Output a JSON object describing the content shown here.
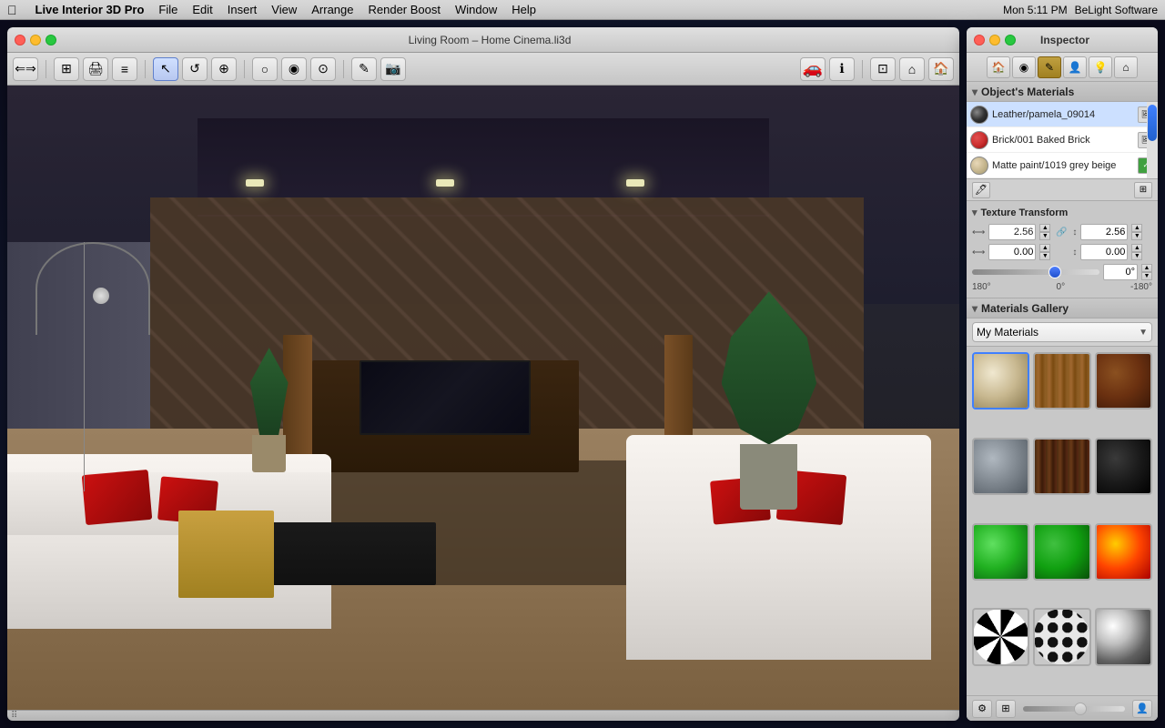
{
  "menubar": {
    "apple": "⌘",
    "items": [
      "Live Interior 3D Pro",
      "File",
      "Edit",
      "Insert",
      "View",
      "Arrange",
      "Render Boost",
      "Window",
      "Help"
    ],
    "right": [
      "Mon 5:11 PM",
      "BeLight Software"
    ]
  },
  "window3d": {
    "title": "Living Room – Home Cinema.li3d",
    "toolbar_buttons": [
      "←→",
      "⊞",
      "🖨",
      "≡",
      "↖",
      "↺",
      "⊕",
      "⊙",
      "⊙",
      "○",
      "⊙",
      "✎",
      "📷",
      "🏠",
      "🏠",
      "🏠",
      "🏠",
      "ℹ"
    ]
  },
  "inspector": {
    "title": "Inspector",
    "tabs": [
      "house",
      "sphere",
      "brush",
      "person",
      "bulb",
      "home"
    ],
    "objects_materials_label": "Object's Materials",
    "materials": [
      {
        "name": "Leather/pamela_09014",
        "color": "#3a3a3a",
        "has_icon": true
      },
      {
        "name": "Brick/001 Baked Brick",
        "color": "#cc3030",
        "has_icon": true
      },
      {
        "name": "Matte paint/1019 grey beige",
        "color": "#d8c8a8",
        "has_icon": true
      }
    ],
    "texture_transform": {
      "label": "Texture Transform",
      "scale_h": "2.56",
      "scale_v": "2.56",
      "offset_h": "0.00",
      "offset_v": "0.00",
      "rotation": "0°",
      "rotation_min": "180°",
      "rotation_mid": "0°",
      "rotation_max": "-180°"
    },
    "gallery": {
      "label": "Materials Gallery",
      "dropdown_value": "My Materials",
      "items": [
        {
          "id": "beige",
          "label": "Beige fabric"
        },
        {
          "id": "wood",
          "label": "Light wood"
        },
        {
          "id": "brick",
          "label": "Dark brick"
        },
        {
          "id": "stone",
          "label": "Stone"
        },
        {
          "id": "darkwood",
          "label": "Dark wood"
        },
        {
          "id": "black",
          "label": "Black"
        },
        {
          "id": "green-bright",
          "label": "Bright green"
        },
        {
          "id": "green-mid",
          "label": "Mid green"
        },
        {
          "id": "fire",
          "label": "Fire"
        },
        {
          "id": "zebra",
          "label": "Zebra"
        },
        {
          "id": "spots",
          "label": "Spots"
        },
        {
          "id": "chrome",
          "label": "Chrome"
        }
      ]
    }
  }
}
